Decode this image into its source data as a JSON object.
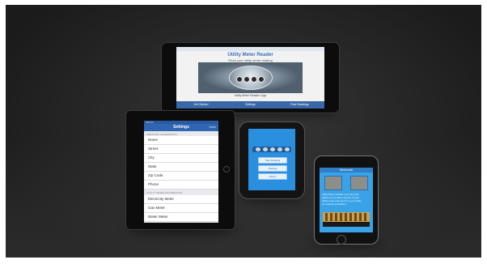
{
  "photo": {
    "subject": "Utility Meter Reader app shown on four mobile devices"
  },
  "tablet_landscape": {
    "title": "Utility Meter Reader",
    "subtitle": "Read your utility meter reading",
    "caption": "Utility Meter Reader Logo",
    "buttons": [
      "Get Started",
      "Settings",
      "Past Readings"
    ]
  },
  "tablet_portrait": {
    "status": "Verizon",
    "nav_title": "Settings",
    "nav_action": "Done",
    "section1": "PERSONAL INFORMATION",
    "personal_fields": [
      "Name",
      "Street",
      "City",
      "State",
      "Zip Code",
      "Phone"
    ],
    "section2": "UTILITY METER INFORMATION",
    "meter_fields": [
      "Electricity Meter",
      "Gas Meter",
      "Water Meter"
    ]
  },
  "phone_small": {
    "buttons": [
      "Take Reading",
      "Settings",
      "History"
    ]
  },
  "iphone": {
    "header_title": "Welcome",
    "body_text": [
      "Utility Meter Reader is an app that",
      "allows you to take a picture of your",
      "utility meter and send it to your utility",
      "for reading verification."
    ]
  },
  "colors": {
    "app_blue": "#3a67a8",
    "phone_screen_blue": "#2b8fe0",
    "backdrop": "#2a2a2a"
  }
}
